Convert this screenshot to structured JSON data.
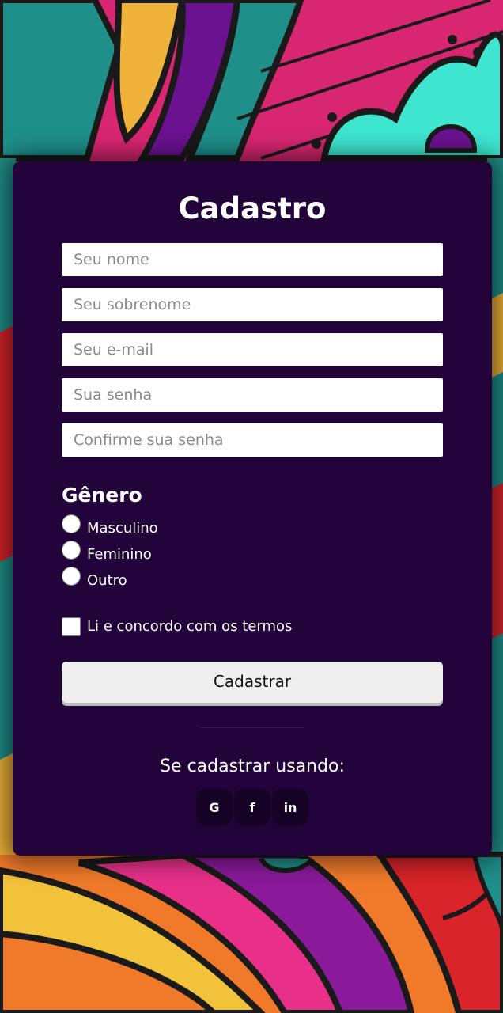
{
  "form": {
    "title": "Cadastro",
    "fields": {
      "first_name_placeholder": "Seu nome",
      "last_name_placeholder": "Seu sobrenome",
      "email_placeholder": "Seu e-mail",
      "password_placeholder": "Sua senha",
      "confirm_password_placeholder": "Confirme sua senha"
    },
    "gender": {
      "heading": "Gênero",
      "options": [
        "Masculino",
        "Feminino",
        "Outro"
      ]
    },
    "terms_label": "Li e concordo com os termos",
    "submit_label": "Cadastrar"
  },
  "social": {
    "prompt": "Se cadastrar usando:",
    "google": "G",
    "facebook": "f",
    "linkedin": "in",
    "icons": [
      "google-icon",
      "facebook-icon",
      "linkedin-icon"
    ]
  },
  "colors": {
    "card_background": "#22043a",
    "social_button_background": "#160224",
    "submit_background": "#efefef"
  }
}
